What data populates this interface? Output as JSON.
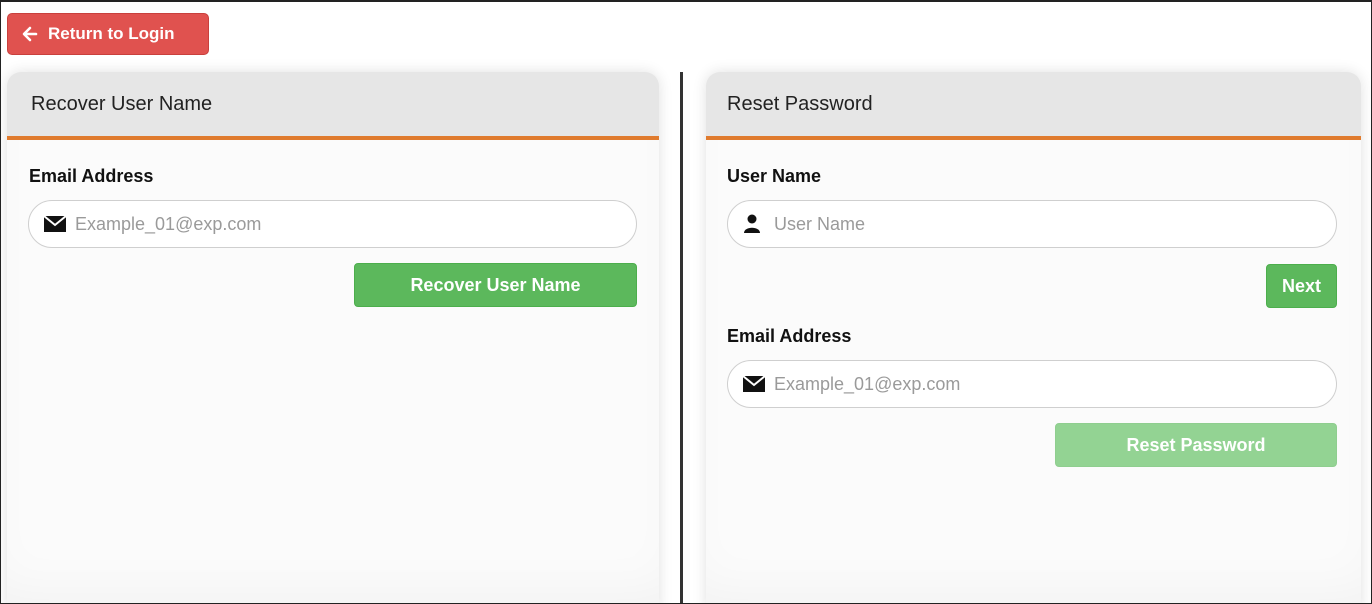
{
  "back_button": {
    "label": "Return to Login",
    "icon": "arrow-left-icon",
    "color": "#e0524f"
  },
  "recover_panel": {
    "title": "Recover User Name",
    "email": {
      "label": "Email Address",
      "placeholder": "Example_01@exp.com",
      "value": "",
      "icon": "envelope-icon"
    },
    "submit_label": "Recover User Name"
  },
  "reset_panel": {
    "title": "Reset Password",
    "username": {
      "label": "User Name",
      "placeholder": "User Name",
      "value": "",
      "icon": "user-icon"
    },
    "next_label": "Next",
    "email": {
      "label": "Email Address",
      "placeholder": "Example_01@exp.com",
      "value": "",
      "icon": "envelope-icon"
    },
    "submit_label": "Reset Password",
    "submit_disabled": true
  },
  "colors": {
    "accent": "#e07b2e",
    "success": "#5cb85c",
    "success_disabled": "#93d393",
    "danger": "#e0524f",
    "header_bg": "#e6e6e6"
  }
}
